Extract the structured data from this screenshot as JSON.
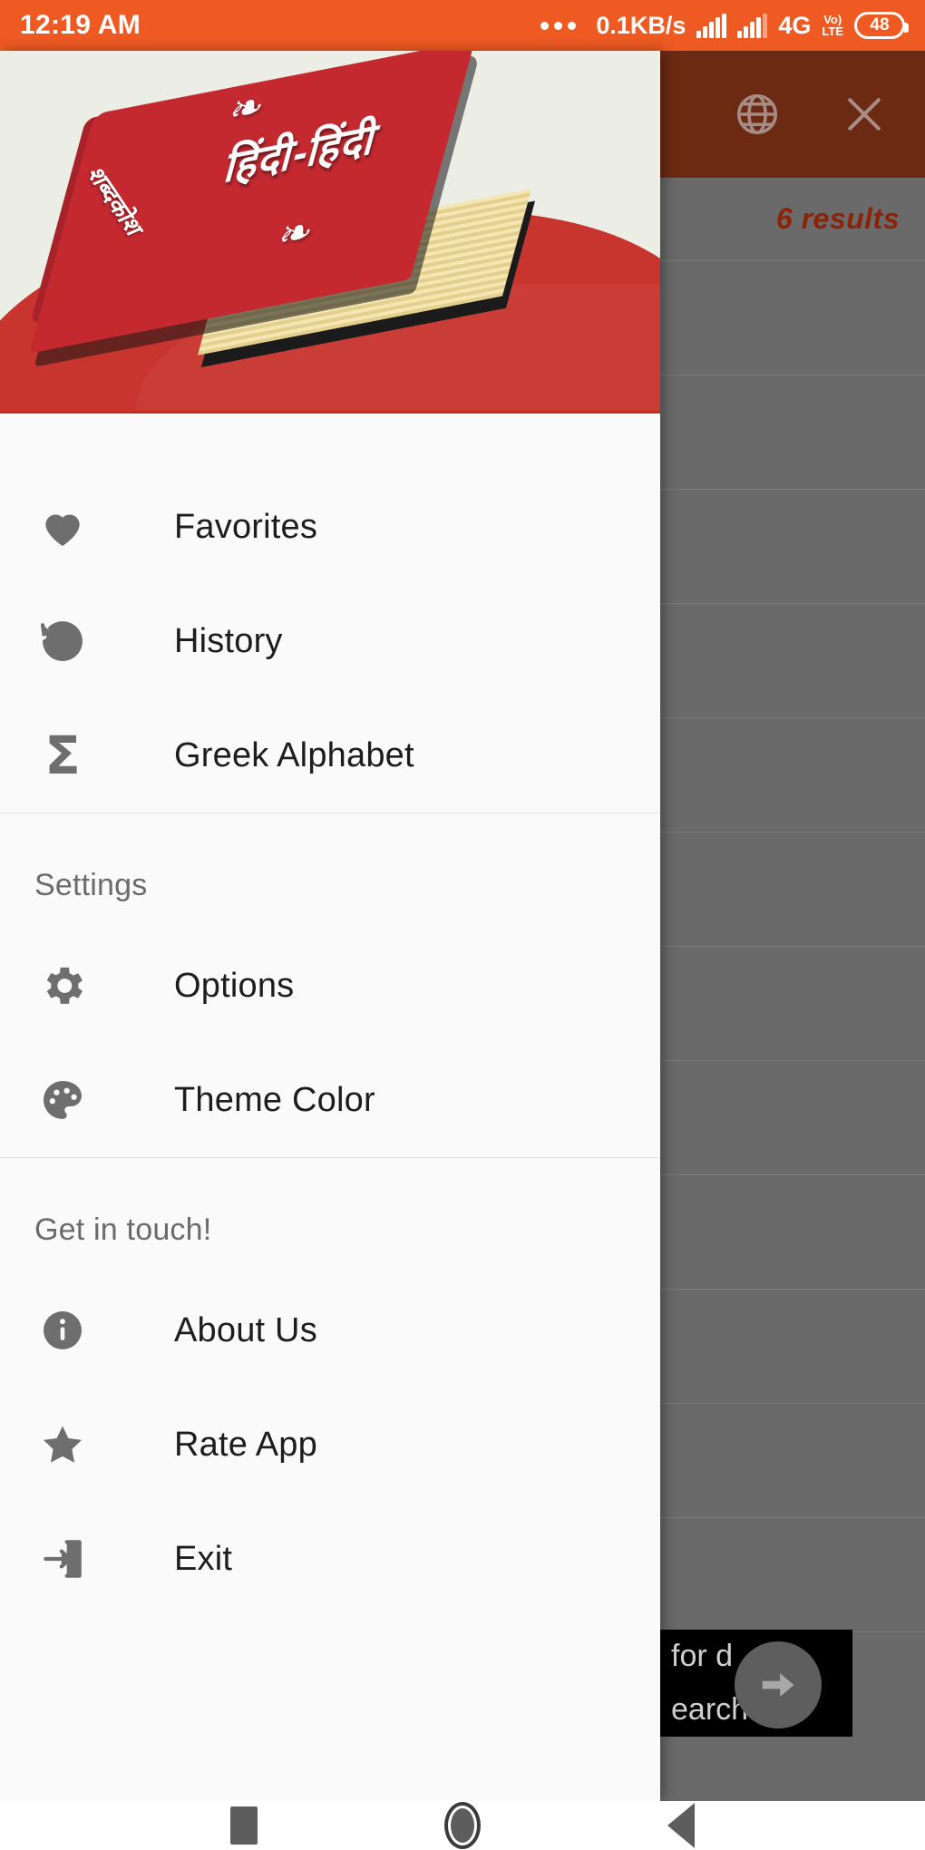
{
  "status_bar": {
    "clock": "12:19 AM",
    "overflow_icon": "more-dots-icon",
    "net_speed": "0.1KB/s",
    "signal_icon_1": "signal-bars-icon",
    "signal_icon_2": "signal-bars-icon",
    "network_type": "4G",
    "volte_line1": "Vo)",
    "volte_line2": "LTE",
    "battery_level": "48"
  },
  "background_app": {
    "toolbar": {
      "language_icon": "globe-icon",
      "close_icon": "close-icon"
    },
    "results_label": "6 results",
    "toast": {
      "line1": "for d",
      "line2": "earch"
    },
    "fab_icon": "arrow-right-icon"
  },
  "drawer": {
    "header": {
      "book_title": "हिंदी-हिंदी",
      "book_subtitle": "शब्दकोश",
      "flourish_top": "❧",
      "flourish_bottom": "❧"
    },
    "groups": [
      {
        "label": null,
        "items": [
          {
            "label": "Favorites",
            "icon": "heart-icon"
          },
          {
            "label": "History",
            "icon": "history-icon"
          },
          {
            "label": "Greek Alphabet",
            "icon": "sigma-icon"
          }
        ]
      },
      {
        "label": "Settings",
        "items": [
          {
            "label": "Options",
            "icon": "gear-icon"
          },
          {
            "label": "Theme Color",
            "icon": "palette-icon"
          }
        ]
      },
      {
        "label": "Get in touch!",
        "items": [
          {
            "label": "About Us",
            "icon": "info-circle-icon"
          },
          {
            "label": "Rate App",
            "icon": "star-icon"
          },
          {
            "label": "Exit",
            "icon": "exit-icon"
          }
        ]
      }
    ]
  },
  "nav_bar": {
    "recents_icon": "square-recents-icon",
    "home_icon": "circle-home-icon",
    "back_icon": "triangle-back-icon"
  },
  "colors": {
    "status_bar": "#ef5a22",
    "toolbar_dimmed": "#6d2a13",
    "scrim": "#6a6a6a",
    "drawer_bg": "#fafafa",
    "accent_red": "#c3292f",
    "results_text": "#8c2208"
  }
}
